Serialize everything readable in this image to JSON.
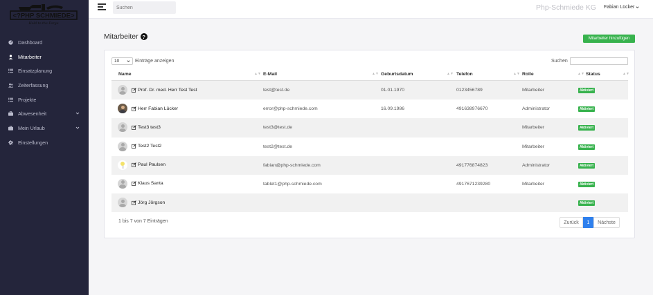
{
  "logo": {
    "text": "<?PHP SCHMIEDE>",
    "tagline": "Hold to the Forge"
  },
  "sidebar": {
    "items": [
      {
        "label": "Dashboard",
        "icon": "dashboard-icon",
        "active": false
      },
      {
        "label": "Mitarbeiter",
        "icon": "user-icon",
        "active": true
      },
      {
        "label": "Einsatzplanung",
        "icon": "list-icon",
        "active": false
      },
      {
        "label": "Zeiterfassung",
        "icon": "users-icon",
        "active": false
      },
      {
        "label": "Projekte",
        "icon": "list-icon",
        "active": false
      },
      {
        "label": "Abwesenheit",
        "icon": "briefcase-icon",
        "active": false,
        "expandable": true
      },
      {
        "label": "Mein Urlaub",
        "icon": "briefcase-icon",
        "active": false,
        "expandable": true
      },
      {
        "label": "Einstellungen",
        "icon": "gear-icon",
        "active": false
      }
    ]
  },
  "topbar": {
    "search_placeholder": "Suchen",
    "brand": "Php-Schmiede KG",
    "user": "Fabian Lücker"
  },
  "page": {
    "title": "Mitarbeiter",
    "add_button": "Mitarbeiter hinzufügen"
  },
  "table": {
    "length_value": "10",
    "length_label": "Einträge anzeigen",
    "search_label": "Suchen",
    "columns": [
      "Name",
      "E-Mail",
      "Geburtsdatum",
      "Telefon",
      "Rolle",
      "Status"
    ],
    "rows": [
      {
        "name": "Prof. Dr. med. Herr Test Test",
        "email": "test@test.de",
        "birthdate": "01.01.1970",
        "phone": "0123456789",
        "role": "Mitarbeiter",
        "status": "Aktiviert",
        "avatar": "default"
      },
      {
        "name": "Herr Fabian Lücker",
        "email": "error@php-schmiede.com",
        "birthdate": "16.09.1986",
        "phone": "491638976670",
        "role": "Administrator",
        "status": "Aktiviert",
        "avatar": "photo"
      },
      {
        "name": "Test3 test3",
        "email": "test3@test.de",
        "birthdate": "",
        "phone": "",
        "role": "Mitarbeiter",
        "status": "Aktiviert",
        "avatar": "default"
      },
      {
        "name": "Test2 Test2",
        "email": "test2@test.de",
        "birthdate": "",
        "phone": "",
        "role": "Mitarbeiter",
        "status": "Aktiviert",
        "avatar": "default"
      },
      {
        "name": "Paul Paulsen",
        "email": "fabian@php-schmiede.com",
        "birthdate": "",
        "phone": "491776874823",
        "role": "Administrator",
        "status": "Aktiviert",
        "avatar": "lamp"
      },
      {
        "name": "Klaus Santa",
        "email": "tablet1@php-schmiede.com",
        "birthdate": "",
        "phone": "4917671239280",
        "role": "Mitarbeiter",
        "status": "Aktiviert",
        "avatar": "default"
      },
      {
        "name": "Jörg Jörgson",
        "email": "",
        "birthdate": "",
        "phone": "",
        "role": "",
        "status": "Aktiviert",
        "avatar": "default"
      }
    ],
    "info": "1 bis 7 von 7 Einträgen",
    "pagination": {
      "prev": "Zurück",
      "current": "1",
      "next": "Nächste"
    }
  },
  "colors": {
    "sidebar": "#24253b",
    "accent_green": "#37b24d",
    "accent_blue": "#2f80ed"
  }
}
